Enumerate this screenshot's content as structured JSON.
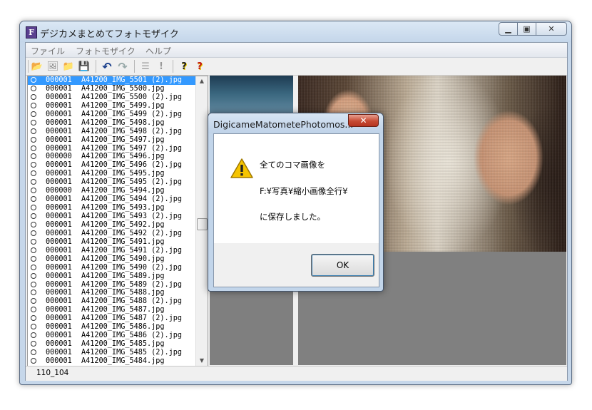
{
  "window": {
    "title": "デジカメまとめてフォトモザイク",
    "icon_letter": "F",
    "minimize_glyph": "▁",
    "maximize_glyph": "▣",
    "close_glyph": "✕"
  },
  "menu": [
    "ファイル",
    "フォトモザイク",
    "ヘルプ"
  ],
  "toolbar": {
    "buttons": [
      "open-folder-icon",
      "open-image-icon",
      "folder-icon",
      "save-icon",
      "undo-icon",
      "redo-icon",
      "list-icon",
      "exclamation-icon",
      "help-icon",
      "context-help-icon"
    ],
    "glyphs": {
      "open": "📂",
      "open_image": "🖼",
      "folder": "📁",
      "save": "💾",
      "undo": "↶",
      "redo": "↷",
      "list": "☰",
      "exclaim": "!",
      "help": "?",
      "context_help": "?"
    }
  },
  "file_list": [
    {
      "num": "000001",
      "name": "A41200_IMG_5501 (2).jpg",
      "selected": true
    },
    {
      "num": "000001",
      "name": "A41200_IMG_5500.jpg"
    },
    {
      "num": "000001",
      "name": "A41200_IMG_5500 (2).jpg"
    },
    {
      "num": "000001",
      "name": "A41200_IMG_5499.jpg"
    },
    {
      "num": "000001",
      "name": "A41200_IMG_5499 (2).jpg"
    },
    {
      "num": "000001",
      "name": "A41200_IMG_5498.jpg"
    },
    {
      "num": "000001",
      "name": "A41200_IMG_5498 (2).jpg"
    },
    {
      "num": "000001",
      "name": "A41200_IMG_5497.jpg"
    },
    {
      "num": "000001",
      "name": "A41200_IMG_5497 (2).jpg"
    },
    {
      "num": "000000",
      "name": "A41200_IMG_5496.jpg"
    },
    {
      "num": "000001",
      "name": "A41200_IMG_5496 (2).jpg"
    },
    {
      "num": "000001",
      "name": "A41200_IMG_5495.jpg"
    },
    {
      "num": "000001",
      "name": "A41200_IMG_5495 (2).jpg"
    },
    {
      "num": "000000",
      "name": "A41200_IMG_5494.jpg"
    },
    {
      "num": "000001",
      "name": "A41200_IMG_5494 (2).jpg"
    },
    {
      "num": "000001",
      "name": "A41200_IMG_5493.jpg"
    },
    {
      "num": "000001",
      "name": "A41200_IMG_5493 (2).jpg"
    },
    {
      "num": "000001",
      "name": "A41200_IMG_5492.jpg"
    },
    {
      "num": "000001",
      "name": "A41200_IMG_5492 (2).jpg"
    },
    {
      "num": "000001",
      "name": "A41200_IMG_5491.jpg"
    },
    {
      "num": "000001",
      "name": "A41200_IMG_5491 (2).jpg"
    },
    {
      "num": "000001",
      "name": "A41200_IMG_5490.jpg"
    },
    {
      "num": "000001",
      "name": "A41200_IMG_5490 (2).jpg"
    },
    {
      "num": "000001",
      "name": "A41200_IMG_5489.jpg"
    },
    {
      "num": "000001",
      "name": "A41200_IMG_5489 (2).jpg"
    },
    {
      "num": "000001",
      "name": "A41200_IMG_5488.jpg"
    },
    {
      "num": "000001",
      "name": "A41200_IMG_5488 (2).jpg"
    },
    {
      "num": "000001",
      "name": "A41200_IMG_5487.jpg"
    },
    {
      "num": "000001",
      "name": "A41200_IMG_5487 (2).jpg"
    },
    {
      "num": "000001",
      "name": "A41200_IMG_5486.jpg"
    },
    {
      "num": "000001",
      "name": "A41200_IMG_5486 (2).jpg"
    },
    {
      "num": "000001",
      "name": "A41200_IMG_5485.jpg"
    },
    {
      "num": "000001",
      "name": "A41200_IMG_5485 (2).jpg"
    },
    {
      "num": "000001",
      "name": "A41200_IMG_5484.jpg"
    }
  ],
  "scrollbar": {
    "up": "▲",
    "down": "▼"
  },
  "status": {
    "text": "110_104"
  },
  "dialog": {
    "title": "DigicameMatometePhotomos...",
    "close_glyph": "✕",
    "icon": "warning-icon",
    "messages": [
      "全てのコマ画像を",
      "F:¥写真¥縮小画像全行¥",
      "に保存しました。"
    ],
    "ok_label": "OK"
  },
  "colors": {
    "selection": "#3399ff",
    "close_red": "#c74a33",
    "warning_yellow": "#f5c400"
  }
}
